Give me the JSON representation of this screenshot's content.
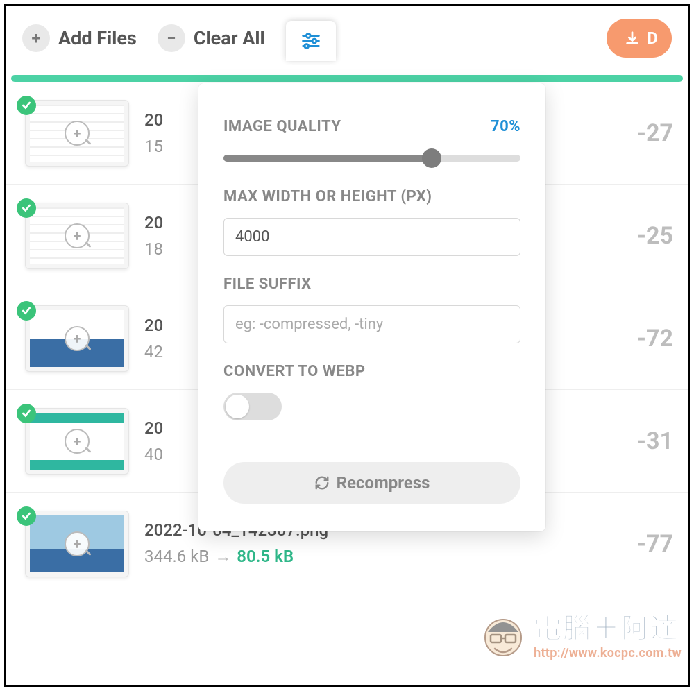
{
  "toolbar": {
    "add_label": "Add Files",
    "clear_label": "Clear All",
    "download_label": "D"
  },
  "settings": {
    "quality_label": "IMAGE QUALITY",
    "quality_value": "70%",
    "quality_percent": 70,
    "max_dim_label": "MAX WIDTH OR HEIGHT (PX)",
    "max_dim_value": "4000",
    "suffix_label": "FILE SUFFIX",
    "suffix_placeholder": "eg: -compressed, -tiny",
    "webp_label": "CONVERT TO WEBP",
    "webp_on": false,
    "recompress_label": "Recompress"
  },
  "files": [
    {
      "name": "20",
      "size_old": "15",
      "size_new": "",
      "pct": "-27",
      "thumb": "stripes"
    },
    {
      "name": "20",
      "size_old": "18",
      "size_new": "",
      "pct": "-25",
      "thumb": "stripes"
    },
    {
      "name": "20",
      "size_old": "42",
      "size_new": "",
      "pct": "-72",
      "thumb": "half-blue"
    },
    {
      "name": "20",
      "size_old": "40",
      "size_new": "",
      "pct": "-31",
      "thumb": "mixed"
    },
    {
      "name": "2022-10-04_142307.png",
      "size_old": "344.6 kB",
      "size_new": "80.5 kB",
      "pct": "-77",
      "thumb": "sky"
    }
  ],
  "watermark": {
    "title": "電腦王阿達",
    "url": "http://www.kocpc.com.tw"
  }
}
